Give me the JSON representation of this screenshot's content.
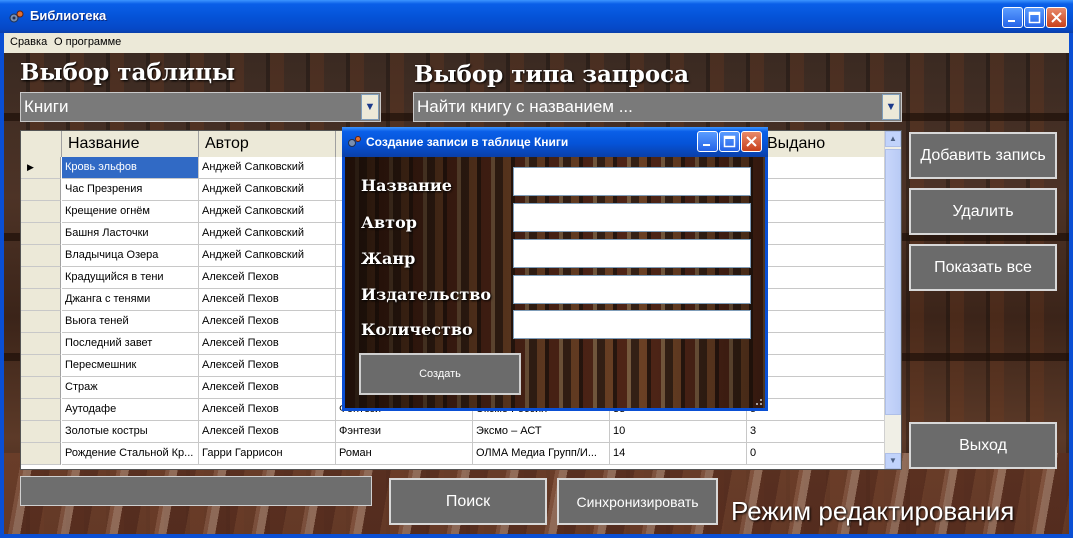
{
  "window": {
    "title": "Библиотека"
  },
  "menu": [
    {
      "label": "Сравка"
    },
    {
      "label": "О программе"
    }
  ],
  "table_select": {
    "label": "Выбор таблицы",
    "value": "Книги"
  },
  "query_select": {
    "label": "Выбор типа запроса",
    "value": "Найти книгу с названием ..."
  },
  "grid": {
    "columns": [
      "Название",
      "Автор",
      "",
      "",
      "",
      "Выдано"
    ],
    "rows": [
      [
        "Кровь эльфов",
        "Анджей Сапковский",
        "",
        "",
        "",
        ""
      ],
      [
        "Час Презрения",
        "Анджей Сапковский",
        "",
        "",
        "",
        ""
      ],
      [
        "Крещение огнём",
        "Анджей Сапковский",
        "",
        "",
        "",
        ""
      ],
      [
        "Башня Ласточки",
        "Анджей Сапковский",
        "",
        "",
        "",
        ""
      ],
      [
        "Владычица Озера",
        "Анджей Сапковский",
        "",
        "",
        "",
        ""
      ],
      [
        "Крадущийся в тени",
        "Алексей Пехов",
        "",
        "",
        "",
        ""
      ],
      [
        "Джанга с тенями",
        "Алексей Пехов",
        "",
        "",
        "",
        ""
      ],
      [
        "Вьюга теней",
        "Алексей Пехов",
        "",
        "",
        "",
        ""
      ],
      [
        "Последний завет",
        "Алексей Пехов",
        "",
        "",
        "",
        ""
      ],
      [
        "Пересмешник",
        "Алексей Пехов",
        "",
        "",
        "",
        ""
      ],
      [
        "Страж",
        "Алексей Пехов",
        "",
        "",
        "",
        ""
      ],
      [
        "Аутодафе",
        "Алексей Пехов",
        "Фэнтези",
        "Эксмо Россия",
        "33",
        "5"
      ],
      [
        "Золотые костры",
        "Алексей Пехов",
        "Фэнтези",
        "Эксмо – АСТ",
        "10",
        "3"
      ],
      [
        "Рождение Стальной Кр...",
        "Гарри Гаррисон",
        "Роман",
        "ОЛМА Медиа Групп/И...",
        "14",
        "0"
      ]
    ]
  },
  "buttons": {
    "add": "Добавить запись",
    "delete": "Удалить",
    "show_all": "Показать все",
    "exit": "Выход",
    "search": "Поиск",
    "sync": "Синхронизировать"
  },
  "mode_label": "Режим редактирования",
  "dialog": {
    "title": "Создание записи в таблице Книги",
    "fields": [
      "Название",
      "Автор",
      "Жанр",
      "Издательство",
      "Количество"
    ],
    "create": "Создать"
  }
}
